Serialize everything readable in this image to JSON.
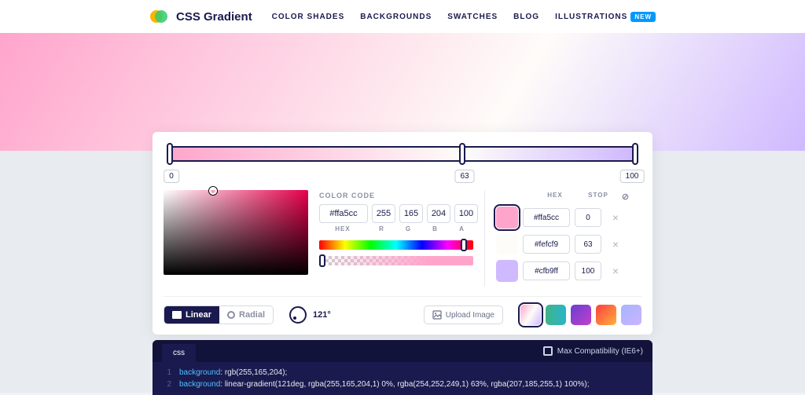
{
  "header": {
    "brand": "CSS Gradient",
    "nav": {
      "shades": "COLOR SHADES",
      "backgrounds": "BACKGROUNDS",
      "swatches": "SWATCHES",
      "blog": "BLOG",
      "illustrations": "ILLUSTRATIONS",
      "new_badge": "NEW"
    }
  },
  "gradient": {
    "stops": [
      {
        "pos": "0",
        "hex": "#ffa5cc"
      },
      {
        "pos": "63",
        "hex": "#fefcf9"
      },
      {
        "pos": "100",
        "hex": "#cfb9ff"
      }
    ]
  },
  "color_code": {
    "title": "COLOR CODE",
    "hex": "#ffa5cc",
    "r": "255",
    "g": "165",
    "b": "204",
    "a": "100",
    "labels": {
      "hex": "HEX",
      "r": "R",
      "g": "G",
      "b": "B",
      "a": "A"
    }
  },
  "stops_table": {
    "headers": {
      "hex": "HEX",
      "stop": "STOP",
      "del": "⊘"
    },
    "rows": [
      {
        "color": "#ffa5cc",
        "hex": "#ffa5cc",
        "pos": "0",
        "active": true
      },
      {
        "color": "#fefcf9",
        "hex": "#fefcf9",
        "pos": "63",
        "active": false
      },
      {
        "color": "#cfb9ff",
        "hex": "#cfb9ff",
        "pos": "100",
        "active": false
      }
    ]
  },
  "type": {
    "linear": "Linear",
    "radial": "Radial"
  },
  "angle": "121°",
  "upload": "Upload Image",
  "presets": [
    "linear-gradient(121deg,#ffa5cc,#fefcf9,#cfb9ff)",
    "linear-gradient(90deg,#3eb489,#2bb4c9)",
    "linear-gradient(135deg,#6a3fd1,#c23fca)",
    "linear-gradient(135deg,#ff3d3d,#ffb13d)",
    "linear-gradient(135deg,#a9b4ff,#c9b4ff)"
  ],
  "code": {
    "tab": "css",
    "compat": "Max Compatibility (IE6+)",
    "line1_prop": "background",
    "line1_val": ": rgb(255,165,204);",
    "line2_prop": "background",
    "line2_val": ": linear-gradient(121deg, rgba(255,165,204,1) 0%, rgba(254,252,249,1) 63%, rgba(207,185,255,1) 100%);"
  }
}
